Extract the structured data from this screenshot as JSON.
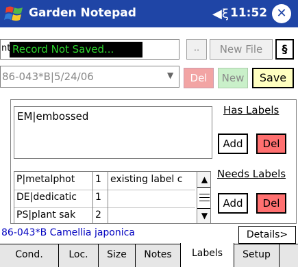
{
  "titlebar": {
    "title": "Garden Notepad",
    "time": "11:52",
    "speaker_icon": "speaker-icon",
    "close_icon": "close-icon"
  },
  "file": {
    "field_value": "nts",
    "status_message": "Record Not Saved...",
    "browse_label": "..",
    "new_file_label": "New File",
    "section_label": "§"
  },
  "record": {
    "selected_value": "86-043*B|5/24/06",
    "del_label": "Del",
    "new_label": "New",
    "save_label": "Save"
  },
  "has_labels": {
    "title": "Has Labels",
    "items": [
      "EM|embossed"
    ],
    "add_label": "Add",
    "del_label": "Del"
  },
  "needs_labels": {
    "title": "Needs Labels",
    "rows": [
      [
        "P|metalphot",
        "1",
        "existing label c"
      ],
      [
        "DE|dedicatic",
        "1",
        ""
      ],
      [
        "PS|plant sak",
        "2",
        ""
      ]
    ],
    "add_label": "Add",
    "del_label": "Del"
  },
  "footer": {
    "record_title": "86-043*B Camellia japonica",
    "details_label": "Details>"
  },
  "tabs": [
    "Cond.",
    "Loc.",
    "Size",
    "Notes",
    "Labels",
    "Setup"
  ],
  "active_tab": "Labels",
  "colors": {
    "titlebar": "#1F45A6",
    "status_text": "#2DD62D",
    "del_button": "#FF7070",
    "new_button": "#C9F0C9",
    "save_button": "#FFFFC0",
    "record_title": "#0000C0"
  }
}
